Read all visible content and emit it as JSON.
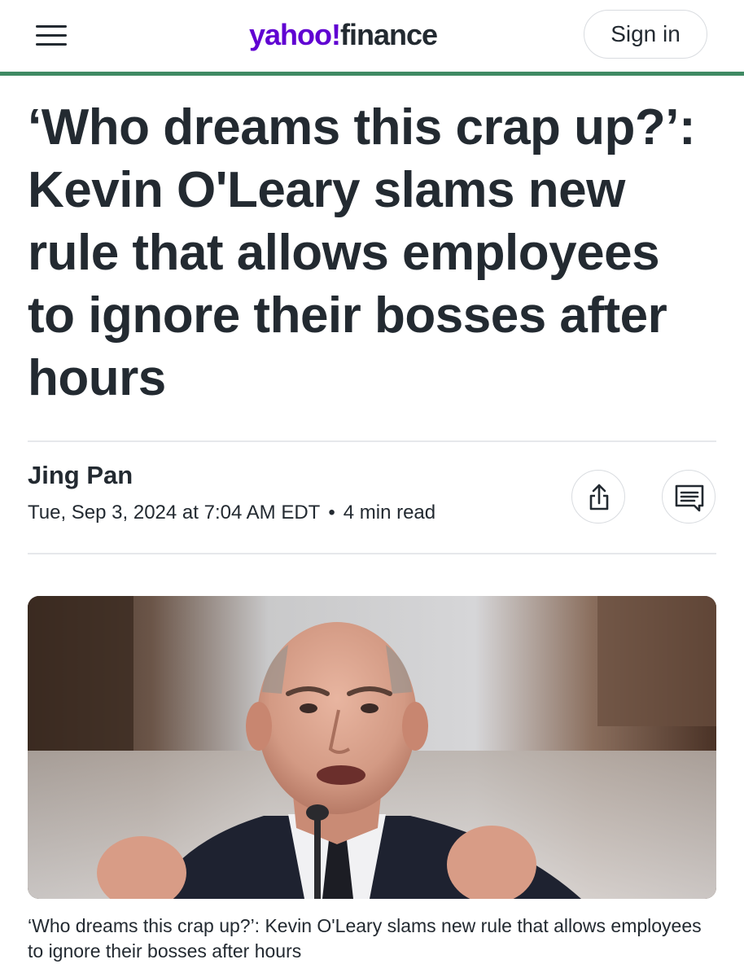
{
  "header": {
    "logo_yahoo": "yahoo!",
    "logo_finance": "finance",
    "signin_label": "Sign in"
  },
  "article": {
    "headline": "‘Who dreams this crap up?’: Kevin O'Leary slams new rule that allows employees to ignore their bosses after hours",
    "author": "Jing Pan",
    "date": "Tue, Sep 3, 2024 at 7:04 AM EDT",
    "separator": "•",
    "read_time": "4 min read",
    "caption": "‘Who dreams this crap up?’: Kevin O'Leary slams new rule that allows employees to ignore their bosses after hours"
  },
  "icons": {
    "menu": "menu-icon",
    "share": "share-icon",
    "comments": "comments-icon"
  },
  "colors": {
    "brand_purple": "#6001d2",
    "accent_green": "#3f8a63",
    "text": "#232a31",
    "divider": "#e6e8eb"
  }
}
